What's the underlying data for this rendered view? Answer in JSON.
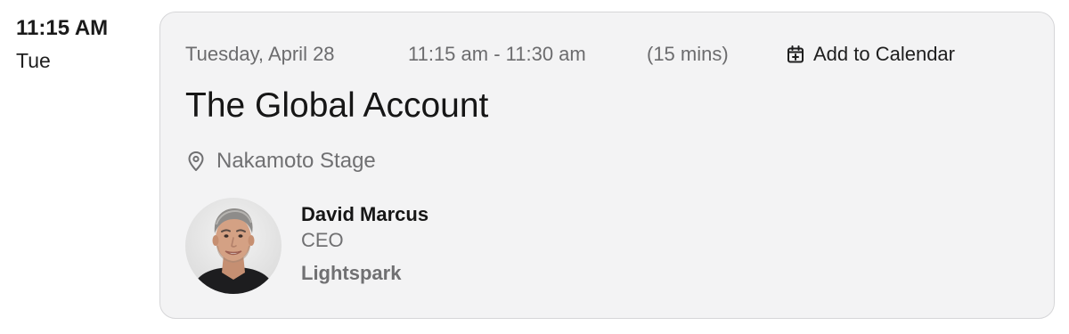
{
  "slot": {
    "time": "11:15 AM",
    "day": "Tue"
  },
  "session": {
    "date": "Tuesday, April 28",
    "time_range": "11:15 am - 11:30 am",
    "duration": "(15 mins)",
    "add_to_calendar_label": "Add to Calendar",
    "add_to_calendar_icon": "calendar-plus-icon",
    "title": "The Global Account",
    "location_icon": "map-pin-icon",
    "location": "Nakamoto Stage"
  },
  "speaker": {
    "name": "David Marcus",
    "role": "CEO",
    "organization": "Lightspark"
  },
  "colors": {
    "card_background": "#f3f3f4",
    "card_border": "#d6d6d8",
    "muted_text": "#6c6c6e",
    "primary_text": "#161616"
  }
}
